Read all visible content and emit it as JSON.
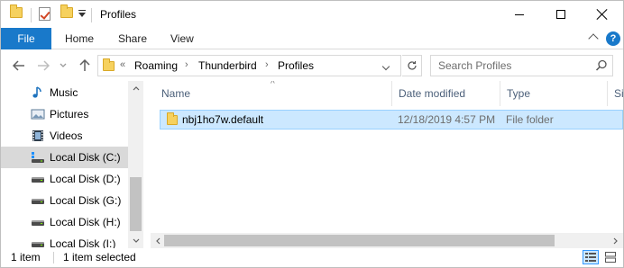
{
  "window": {
    "title": "Profiles"
  },
  "ribbon": {
    "file_label": "File",
    "tabs": [
      {
        "label": "Home"
      },
      {
        "label": "Share"
      },
      {
        "label": "View"
      }
    ],
    "help_label": "?"
  },
  "address_bar": {
    "overflow_chevron": "«",
    "breadcrumbs": [
      {
        "label": "Roaming"
      },
      {
        "label": "Thunderbird"
      },
      {
        "label": "Profiles"
      }
    ],
    "separator": "›"
  },
  "search": {
    "placeholder": "Search Profiles"
  },
  "nav_pane": {
    "items": [
      {
        "label": "Music",
        "icon": "music-icon"
      },
      {
        "label": "Pictures",
        "icon": "pictures-icon"
      },
      {
        "label": "Videos",
        "icon": "videos-icon"
      },
      {
        "label": "Local Disk (C:)",
        "icon": "drive-icon",
        "selected": true
      },
      {
        "label": "Local Disk (D:)",
        "icon": "drive-icon"
      },
      {
        "label": "Local Disk (G:)",
        "icon": "drive-icon"
      },
      {
        "label": "Local Disk (H:)",
        "icon": "drive-icon"
      },
      {
        "label": "Local Disk (I:)",
        "icon": "drive-icon"
      }
    ]
  },
  "file_list": {
    "columns": [
      {
        "label": "Name"
      },
      {
        "label": "Date modified"
      },
      {
        "label": "Type"
      },
      {
        "label": "Size"
      }
    ],
    "rows": [
      {
        "name": "nbj1ho7w.default",
        "date_modified": "12/18/2019 4:57 PM",
        "type": "File folder",
        "selected": true
      }
    ]
  },
  "status_bar": {
    "item_count": "1 item",
    "selected_count": "1 item selected"
  },
  "colors": {
    "accent": "#1979ca",
    "selection_bg": "#cce8ff",
    "selection_border": "#99d1ff",
    "nav_selected_bg": "#d9d9d9",
    "folder_yellow": "#f6d15e"
  }
}
